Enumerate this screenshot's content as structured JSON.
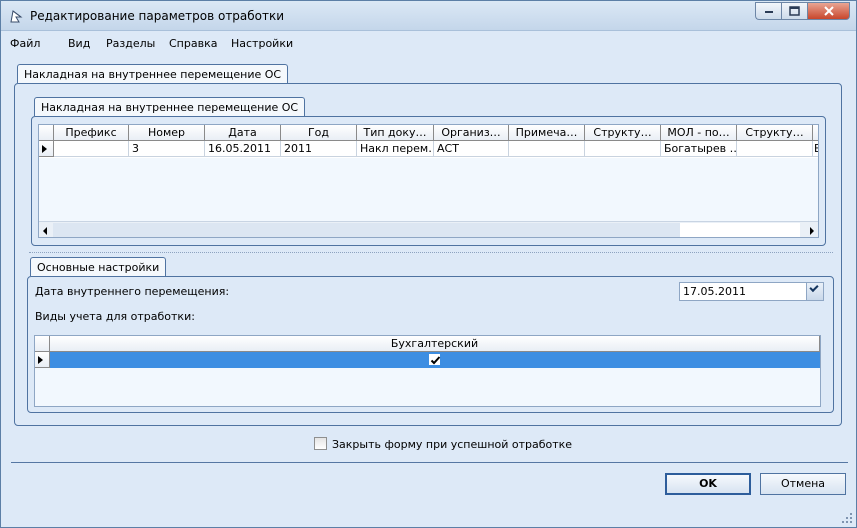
{
  "window": {
    "title": "Редактирование параметров отработки",
    "controls": [
      "minimize-icon",
      "maximize-icon",
      "close-icon"
    ]
  },
  "menu": {
    "items": [
      {
        "label": "Файл"
      },
      {
        "label": "Вид"
      },
      {
        "label": "Разделы"
      },
      {
        "label": "Справка"
      },
      {
        "label": "Настройки"
      }
    ]
  },
  "outer_tab": {
    "label": "Накладная на внутреннее перемещение ОС"
  },
  "inner_tab": {
    "label": "Накладная на внутреннее перемещение ОС"
  },
  "documents_grid": {
    "columns": [
      "Префикс",
      "Номер",
      "Дата",
      "Год",
      "Тип доку…",
      "Организ…",
      "Примеча…",
      "Структу…",
      "МОЛ - по…",
      "Структу…"
    ],
    "rows": [
      [
        "",
        "3",
        "16.05.2011",
        "2011",
        "Накл перем…",
        "АСТ",
        "",
        "",
        "Богатырев …",
        ""
      ]
    ],
    "overflow_cell": "Е"
  },
  "settings_tab": {
    "label": "Основные настройки"
  },
  "settings": {
    "date_label": "Дата внутреннего перемещения:",
    "date_value": "17.05.2011",
    "accounting_label": "Виды учета для отработки:"
  },
  "accounting_grid": {
    "column": "Бухгалтерский",
    "checked": true
  },
  "close_on_success": {
    "label": "Закрыть форму при успешной отработке",
    "checked": false
  },
  "buttons": {
    "ok": "OK",
    "cancel": "Отмена"
  },
  "colors": {
    "window_bg": "#dde9f7",
    "border": "#4f73a1",
    "selected_row": "#3d8ee2"
  }
}
